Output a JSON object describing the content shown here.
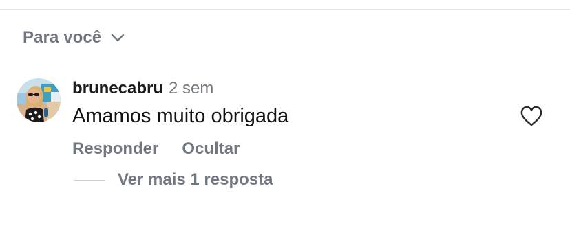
{
  "sort": {
    "label": "Para você",
    "icon": "chevron-down-icon"
  },
  "comment": {
    "username": "brunecabru",
    "time": "2 sem",
    "text": "Amamos muito obrigada",
    "actions": {
      "reply_label": "Responder",
      "hide_label": "Ocultar"
    },
    "replies_label": "Ver mais 1 resposta",
    "like_icon": "heart-icon"
  },
  "colors": {
    "secondary_text": "#717780",
    "primary_text": "#111111",
    "divider": "#e6e6e6"
  }
}
